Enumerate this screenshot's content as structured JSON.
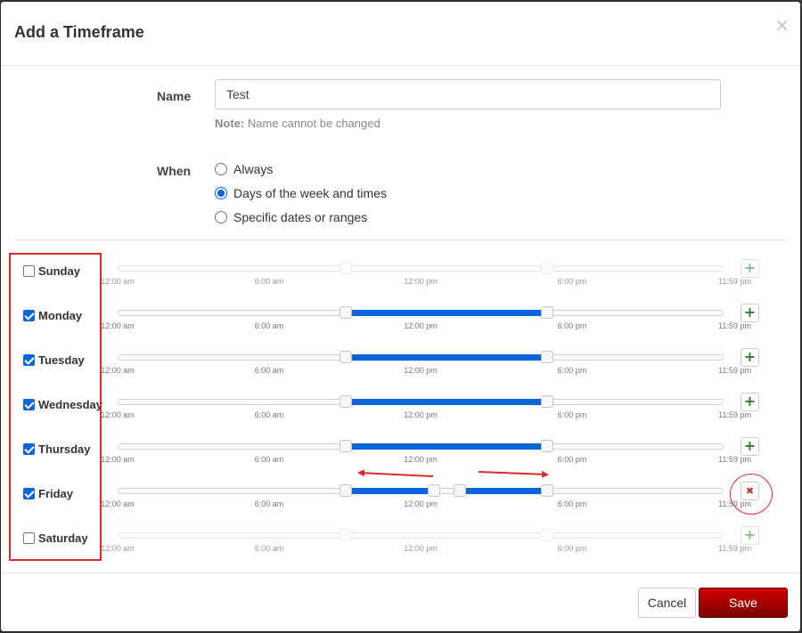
{
  "modal": {
    "title": "Add a Timeframe",
    "close_symbol": "×"
  },
  "name_field": {
    "label": "Name",
    "value": "Test",
    "note_bold": "Note:",
    "note_text": " Name cannot be changed"
  },
  "when_field": {
    "label": "When",
    "options": [
      {
        "label": "Always",
        "checked": false
      },
      {
        "label": "Days of the week and times",
        "checked": true
      },
      {
        "label": "Specific dates or ranges",
        "checked": false
      }
    ]
  },
  "ticks": [
    "12:00 am",
    "6:00 am",
    "12:00 pm",
    "6:00 pm",
    "11:59 pm"
  ],
  "day_rows": [
    {
      "label": "Sunday",
      "checked": false,
      "ranges": [
        {
          "start": 0.375,
          "end": 0.708
        }
      ],
      "action": "add"
    },
    {
      "label": "Monday",
      "checked": true,
      "ranges": [
        {
          "start": 0.375,
          "end": 0.708
        }
      ],
      "action": "add"
    },
    {
      "label": "Tuesday",
      "checked": true,
      "ranges": [
        {
          "start": 0.375,
          "end": 0.708
        }
      ],
      "action": "add"
    },
    {
      "label": "Wednesday",
      "checked": true,
      "ranges": [
        {
          "start": 0.375,
          "end": 0.708
        }
      ],
      "action": "add"
    },
    {
      "label": "Thursday",
      "checked": true,
      "ranges": [
        {
          "start": 0.375,
          "end": 0.708
        }
      ],
      "action": "add"
    },
    {
      "label": "Friday",
      "checked": true,
      "ranges": [
        {
          "start": 0.375,
          "end": 0.52
        },
        {
          "start": 0.563,
          "end": 0.708
        }
      ],
      "action": "remove"
    },
    {
      "label": "Saturday",
      "checked": false,
      "ranges": [
        {
          "start": 0.375,
          "end": 0.708
        }
      ],
      "action": "add"
    }
  ],
  "icons": {
    "add": "+",
    "remove": "✖"
  },
  "annotation_color": "#d92b2b",
  "accent_color": "#0a66d8",
  "footer": {
    "cancel_label": "Cancel",
    "save_label": "Save"
  }
}
